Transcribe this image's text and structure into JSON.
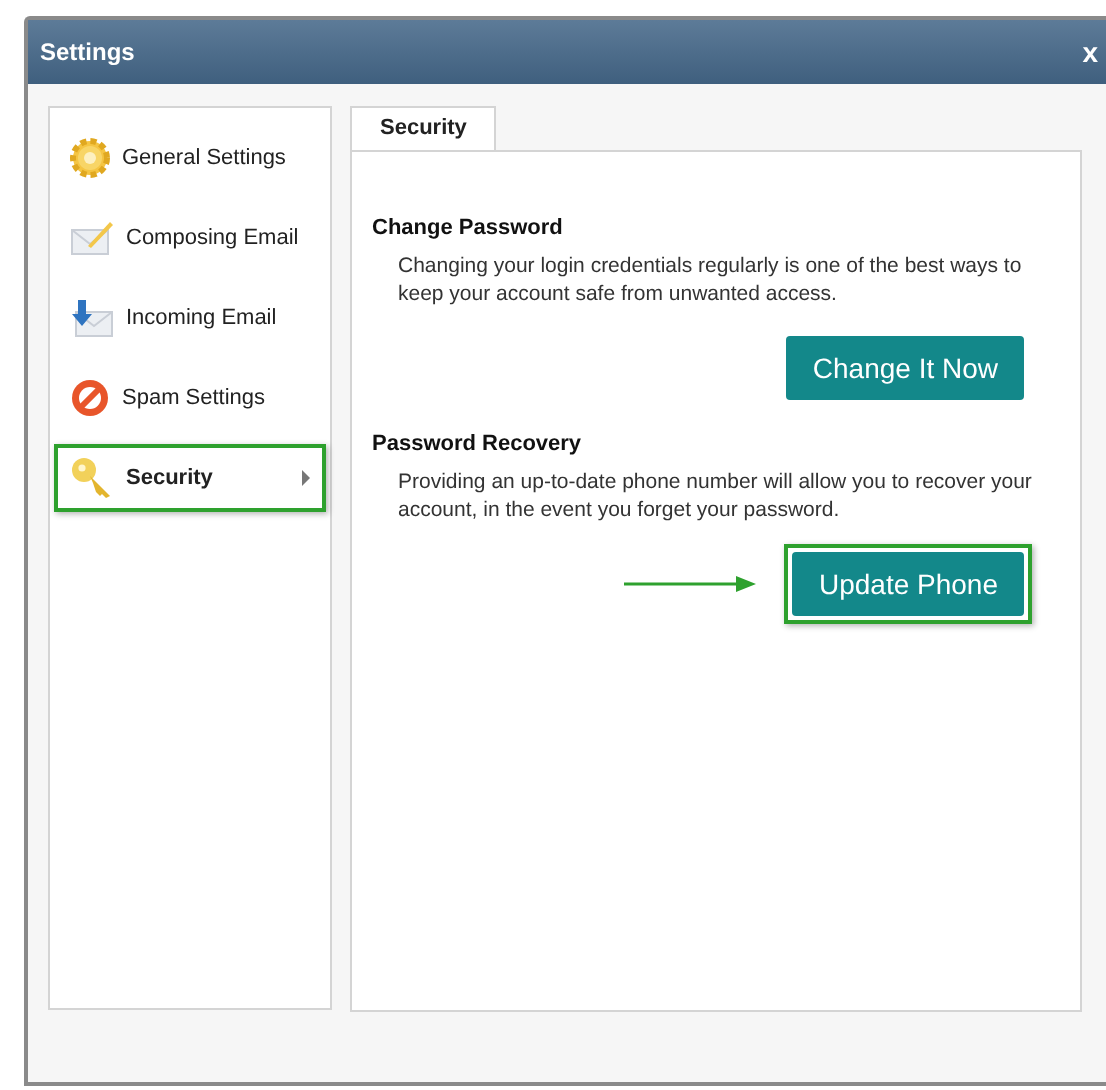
{
  "window": {
    "title": "Settings",
    "close": "x"
  },
  "sidebar": {
    "items": [
      {
        "label": "General Settings",
        "selected": false,
        "highlighted": false
      },
      {
        "label": "Composing Email",
        "selected": false,
        "highlighted": false
      },
      {
        "label": "Incoming Email",
        "selected": false,
        "highlighted": false
      },
      {
        "label": "Spam Settings",
        "selected": false,
        "highlighted": false
      },
      {
        "label": "Security",
        "selected": true,
        "highlighted": true
      }
    ]
  },
  "tabs": [
    {
      "label": "Security",
      "selected": true
    }
  ],
  "sections": [
    {
      "heading": "Change Password",
      "text": "Changing your login credentials regularly is one of the best ways to keep your account safe from unwanted access.",
      "button": "Change It Now",
      "highlighted": false,
      "pointer_arrow": false
    },
    {
      "heading": "Password Recovery",
      "text": "Providing an up-to-date phone number will allow you to recover your account, in the event you forget your password.",
      "button": "Update Phone",
      "highlighted": true,
      "pointer_arrow": true
    }
  ]
}
